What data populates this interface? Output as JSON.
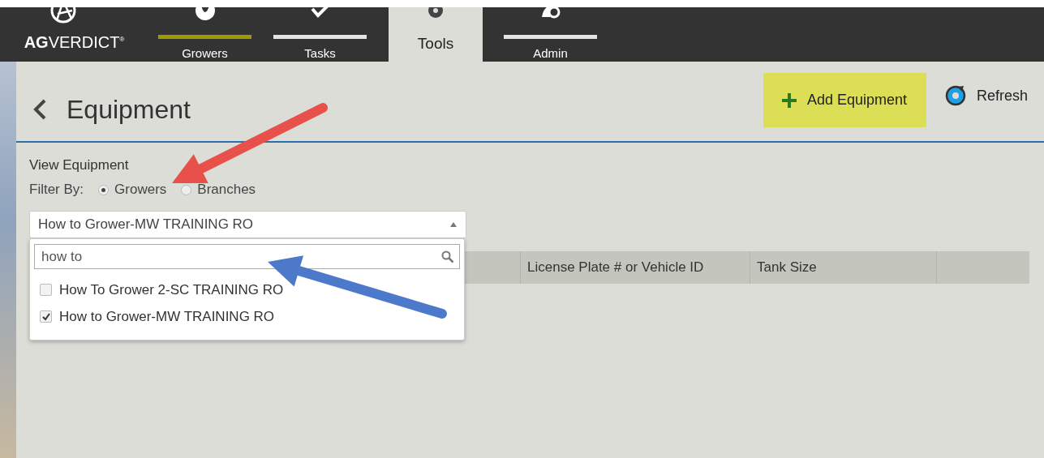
{
  "top_nav": {
    "logo": "**AG**VERDICT$^{®}$",
    "tabs": [
      {
        "label": "Growers",
        "selected": false,
        "color": "#9c9c00"
      },
      {
        "label": "Tasks",
        "selected": false,
        "color": "#e4e4e4"
      },
      {
        "label": "Tools",
        "selected": true
      },
      {
        "label": "Admin",
        "selected": false,
        "color": "#e4e4e4"
      }
    ]
  },
  "page": {
    "title": "Equipment",
    "actions": [
      {
        "kind": "add",
        "label": "Add Equipment",
        "highlighted": true
      },
      {
        "kind": "refresh",
        "label": "Refresh",
        "highlighted": false
      }
    ]
  },
  "filter": {
    "heading": "View Equipment",
    "label": "Filter By:",
    "options": [
      {
        "label": "Growers",
        "selected": true
      },
      {
        "label": "Branches",
        "selected": false
      }
    ]
  },
  "grower_select": {
    "value": "How to Grower-MW TRAINING RO",
    "expanded": true,
    "search": {
      "value": "how to"
    },
    "options": [
      {
        "label": "How To Grower 2-SC TRAINING RO",
        "checked": false
      },
      {
        "label": "How to Grower-MW TRAINING RO",
        "checked": true
      }
    ]
  },
  "table": {
    "columns": [
      "License Plate # or Vehicle ID",
      "Tank Size"
    ]
  },
  "annotations": [
    {
      "kind": "arrow",
      "color": "#e8514a"
    },
    {
      "kind": "arrow",
      "color": "#4d79cb"
    }
  ]
}
